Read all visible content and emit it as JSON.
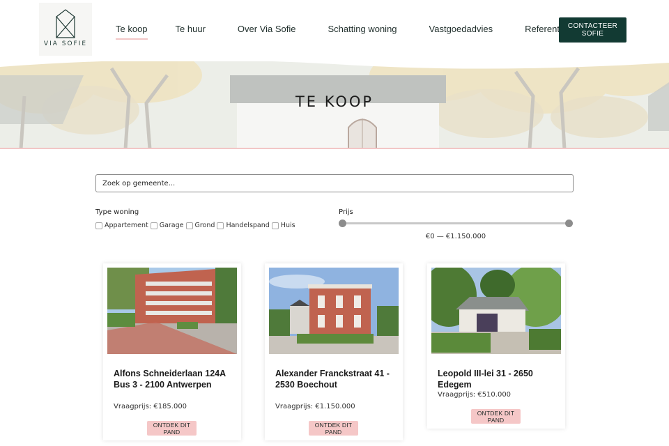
{
  "brand": {
    "logo_text": "VIA SOFIE"
  },
  "nav": {
    "items": [
      {
        "label": "Te koop",
        "active": true
      },
      {
        "label": "Te huur",
        "active": false
      },
      {
        "label": "Over Via Sofie",
        "active": false
      },
      {
        "label": "Schatting woning",
        "active": false
      },
      {
        "label": "Vastgoedadvies",
        "active": false
      },
      {
        "label": "Referenties",
        "active": false
      }
    ],
    "cta_label": "CONTACTEER SOFIE"
  },
  "hero": {
    "title": "TE KOOP"
  },
  "search": {
    "placeholder": "Zoek op gemeente..."
  },
  "filters": {
    "type_label": "Type woning",
    "types": [
      "Appartement",
      "Garage",
      "Grond",
      "Handelspand",
      "Huis"
    ],
    "price_label": "Prijs",
    "price_range": "€0 — €1.150.000"
  },
  "listings": [
    {
      "title": "Alfons Schneiderlaan 124A Bus 3 - 2100 Antwerpen",
      "price": "Vraagprijs: €185.000",
      "button": "ONTDEK DIT PAND"
    },
    {
      "title": "Alexander Franckstraat 41 - 2530 Boechout",
      "price": "Vraagprijs: €1.150.000",
      "button": "ONTDEK DIT PAND"
    },
    {
      "title": "Leopold III-lei 31 - 2650 Edegem",
      "price": "Vraagprijs: €510.000",
      "button": "ONTDEK DIT PAND"
    }
  ],
  "colors": {
    "accent_pink": "#f2c6c6",
    "cta_green": "#123a33"
  }
}
